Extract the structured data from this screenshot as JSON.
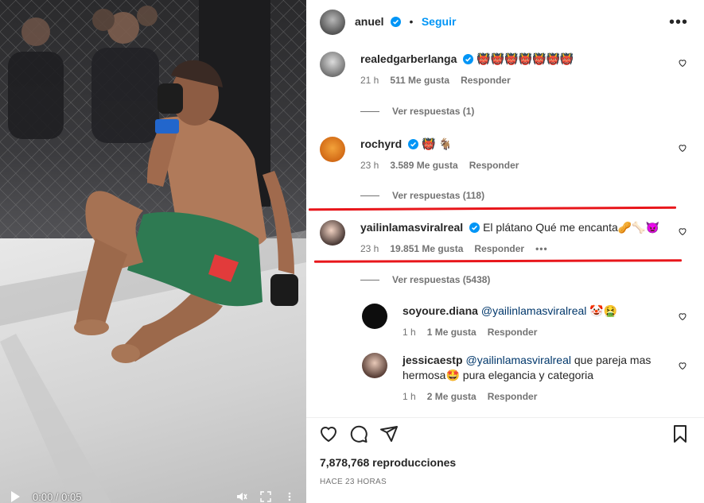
{
  "video": {
    "time": "0:00 / 0:05",
    "icons": [
      "play-icon",
      "mute-icon",
      "fullscreen-icon",
      "settings-icon"
    ]
  },
  "header": {
    "username": "anuel",
    "separator": "•",
    "follow_label": "Seguir",
    "more_label": "•••"
  },
  "comments": [
    {
      "username": "realedgarberlanga",
      "text": "👹👹👹👹👹👹👹",
      "time": "21 h",
      "likes": "511 Me gusta",
      "reply": "Responder",
      "view_replies": "Ver respuestas (1)"
    },
    {
      "username": "rochyrd",
      "text": "👹 🐐",
      "time": "23 h",
      "likes": "3.589 Me gusta",
      "reply": "Responder",
      "view_replies": "Ver respuestas (118)"
    },
    {
      "username": "yailinlamasviralreal",
      "text": "El plátano Qué me encanta🥜🦴👿",
      "time": "23 h",
      "likes": "19.851 Me gusta",
      "reply": "Responder",
      "more": "•••",
      "view_replies": "Ver respuestas (5438)"
    }
  ],
  "replies": [
    {
      "username": "soyoure.diana",
      "mention": "@yailinlamasviralreal",
      "text": " 🤡🤮",
      "time": "1 h",
      "likes": "1 Me gusta",
      "reply": "Responder"
    },
    {
      "username": "jessicaestp",
      "mention": "@yailinlamasviralreal",
      "text": " que pareja mas hermosa🤩 pura elegancia y categoria",
      "time": "1 h",
      "likes": "2 Me gusta",
      "reply": "Responder"
    }
  ],
  "footer": {
    "views": "7,878,768 reproducciones",
    "ago": "HACE 23 HORAS"
  },
  "colors": {
    "accent": "#0095f6",
    "highlight": "#e8161b",
    "muted": "#737373"
  }
}
